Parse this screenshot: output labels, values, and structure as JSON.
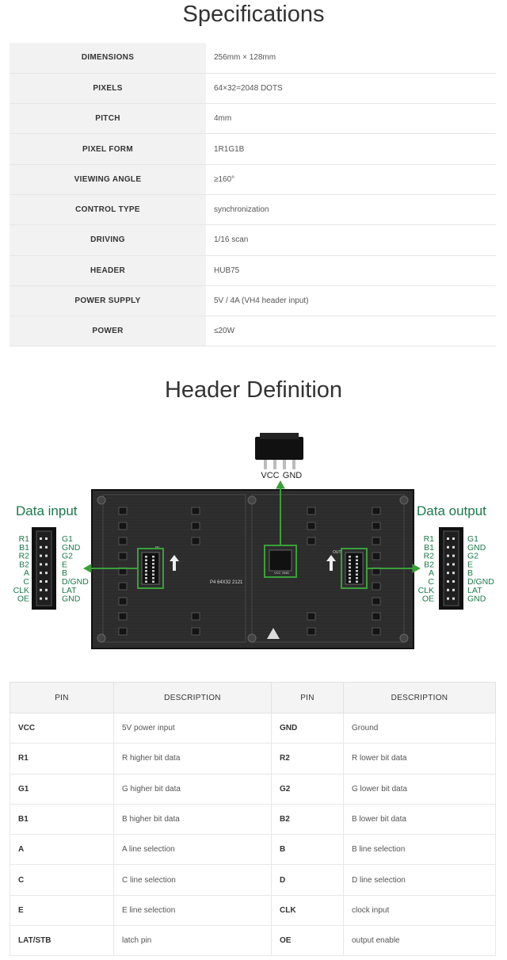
{
  "specifications": {
    "title": "Specifications",
    "rows": [
      {
        "label": "DIMENSIONS",
        "value": "256mm × 128mm"
      },
      {
        "label": "PIXELS",
        "value": "64×32=2048 DOTS"
      },
      {
        "label": "PITCH",
        "value": "4mm"
      },
      {
        "label": "PIXEL FORM",
        "value": "1R1G1B"
      },
      {
        "label": "VIEWING ANGLE",
        "value": "≥160°"
      },
      {
        "label": "CONTROL TYPE",
        "value": "synchronization"
      },
      {
        "label": "DRIVING",
        "value": "1/16 scan"
      },
      {
        "label": "HEADER",
        "value": "HUB75"
      },
      {
        "label": "POWER SUPPLY",
        "value": "5V / 4A (VH4 header input)"
      },
      {
        "label": "POWER",
        "value": "≤20W"
      }
    ]
  },
  "header_definition": {
    "title": "Header Definition",
    "data_input_label": "Data input",
    "data_output_label": "Data output",
    "power_labels": [
      "VCC",
      "GND"
    ],
    "left_pins": [
      "R1",
      "B1",
      "R2",
      "B2",
      "A",
      "C",
      "CLK",
      "OE"
    ],
    "right_pins": [
      "G1",
      "GND",
      "G2",
      "E",
      "B",
      "D/GND",
      "LAT",
      "GND"
    ],
    "board_marking": "P4 64X32 2121",
    "connector_in_label": "IN",
    "connector_out_label": "OUT",
    "vh4_labels": [
      "VCC",
      "GND"
    ],
    "colors": {
      "highlight": "#3aa03a",
      "board": "#2a2a2a",
      "connector": "#1a1a1a"
    }
  },
  "pin_table": {
    "headers": [
      "PIN",
      "DESCRIPTION",
      "PIN",
      "DESCRIPTION"
    ],
    "rows": [
      [
        "VCC",
        "5V power input",
        "GND",
        "Ground"
      ],
      [
        "R1",
        "R higher bit data",
        "R2",
        "R lower bit data"
      ],
      [
        "G1",
        "G higher bit data",
        "G2",
        "G lower bit data"
      ],
      [
        "B1",
        "B higher bit data",
        "B2",
        "B lower bit data"
      ],
      [
        "A",
        "A line selection",
        "B",
        "B line selection"
      ],
      [
        "C",
        "C line selection",
        "D",
        "D line selection"
      ],
      [
        "E",
        "E line selection",
        "CLK",
        "clock input"
      ],
      [
        "LAT/STB",
        "latch pin",
        "OE",
        "output enable"
      ]
    ]
  }
}
